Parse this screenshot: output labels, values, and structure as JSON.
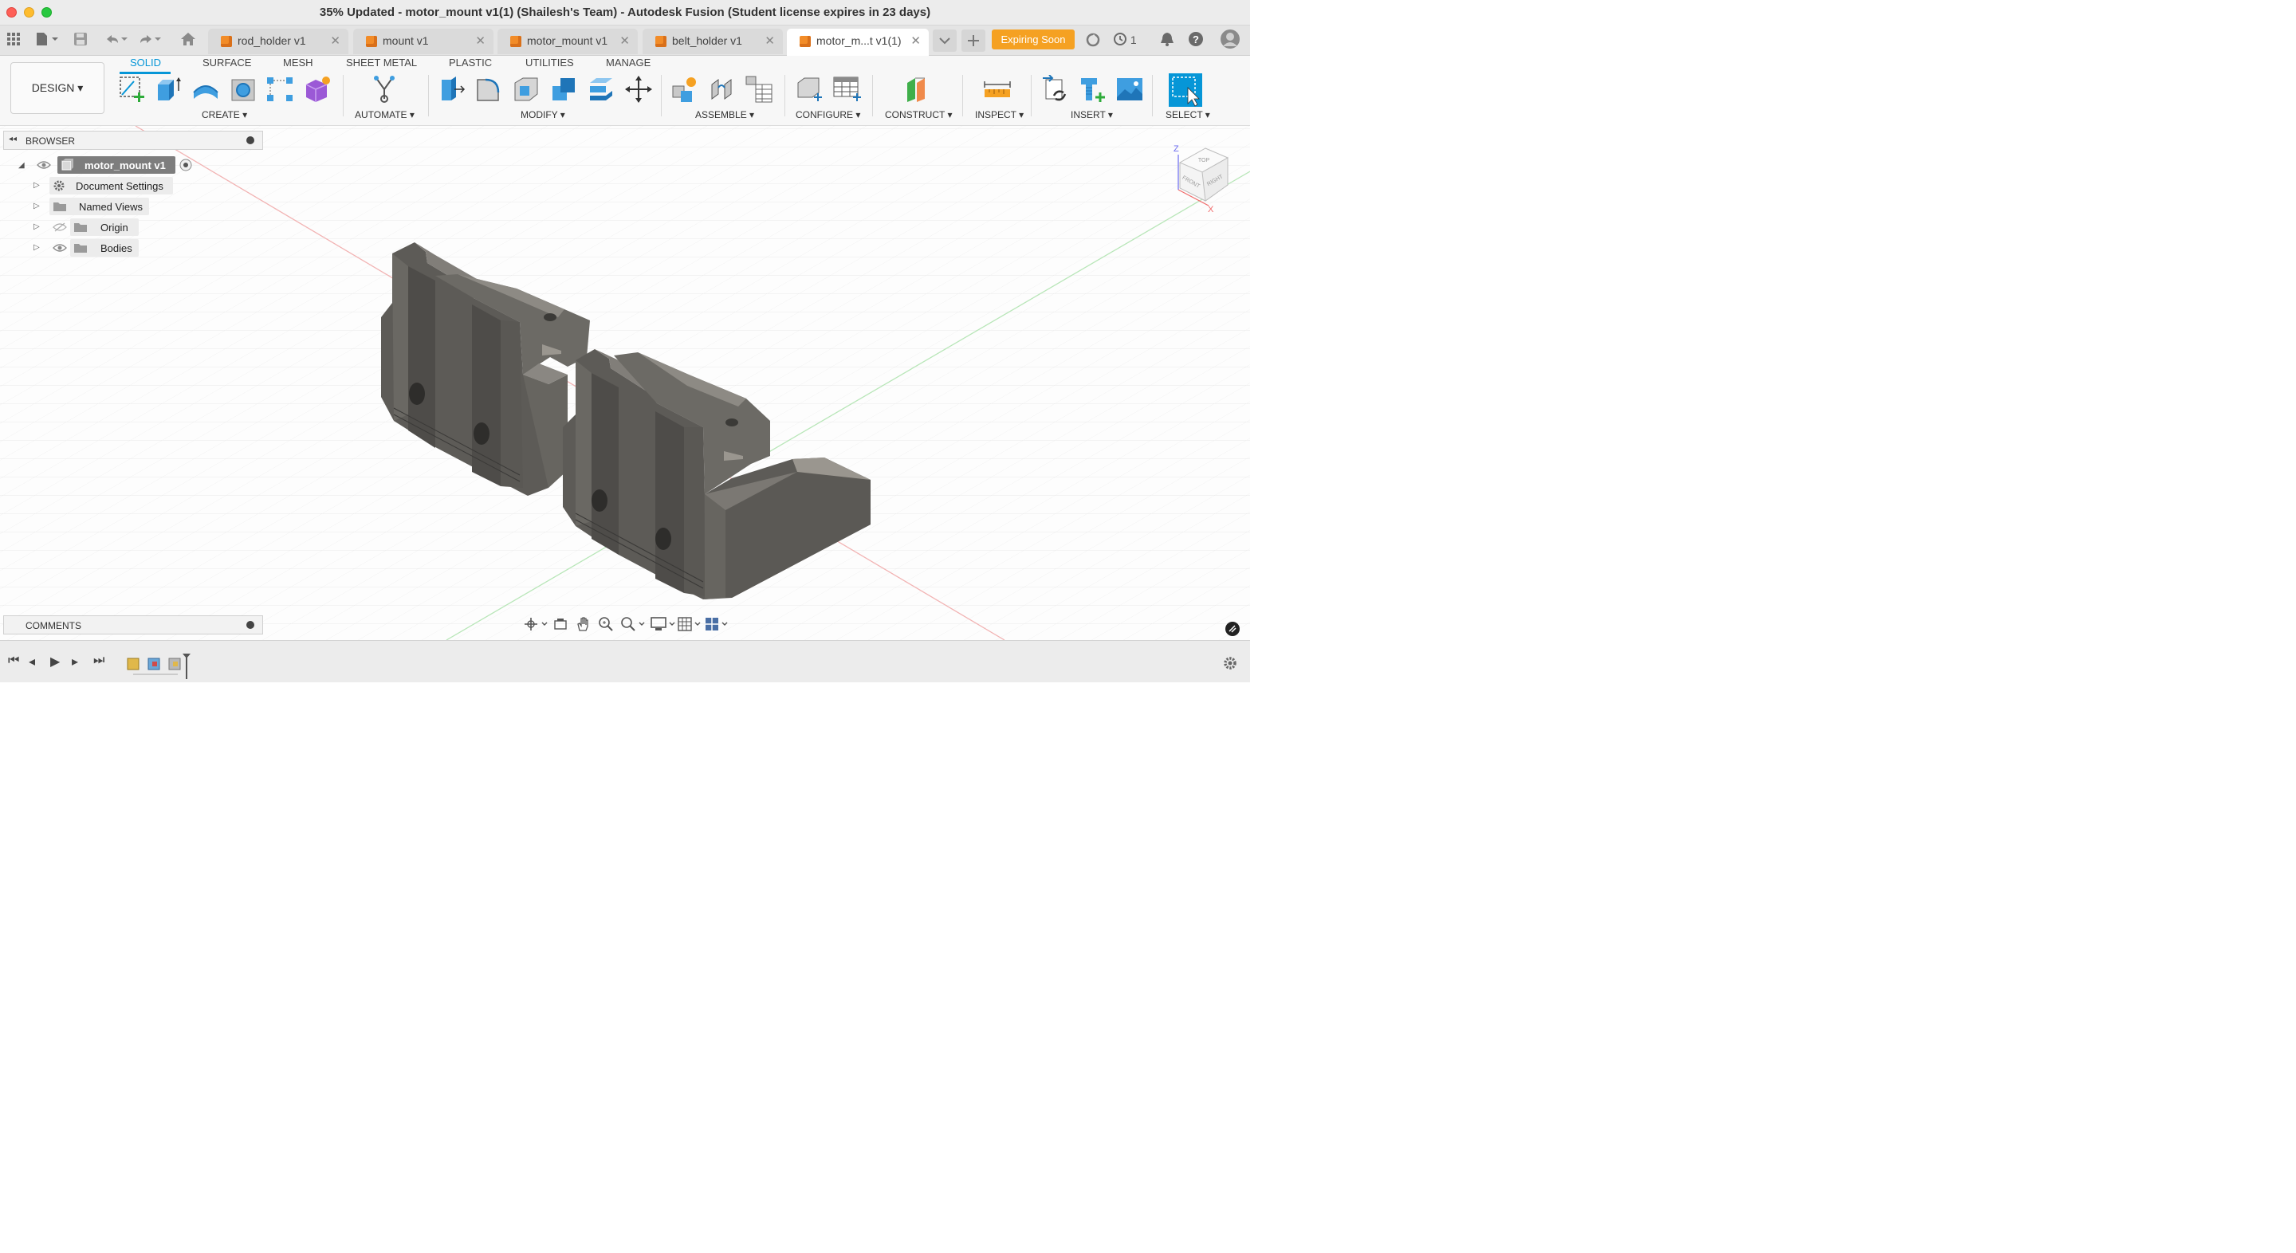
{
  "window": {
    "title": "35% Updated - motor_mount v1(1) (Shailesh's Team) - Autodesk Fusion (Student license expires in 23 days)"
  },
  "tabs": [
    {
      "label": "rod_holder v1",
      "active": false
    },
    {
      "label": "mount v1",
      "active": false
    },
    {
      "label": "motor_mount v1",
      "active": false
    },
    {
      "label": "belt_holder v1",
      "active": false
    },
    {
      "label": "motor_m...t v1(1)",
      "active": true
    }
  ],
  "header": {
    "expiring_label": "Expiring Soon",
    "jobs_count": "1",
    "close_glyph": "✕"
  },
  "workspace": {
    "design_label": "DESIGN",
    "tabs": [
      "SOLID",
      "SURFACE",
      "MESH",
      "SHEET METAL",
      "PLASTIC",
      "UTILITIES",
      "MANAGE"
    ],
    "groups": [
      "CREATE",
      "AUTOMATE",
      "MODIFY",
      "ASSEMBLE",
      "CONFIGURE",
      "CONSTRUCT",
      "INSPECT",
      "INSERT",
      "SELECT"
    ]
  },
  "browser": {
    "title": "BROWSER",
    "root": "motor_mount v1",
    "items": [
      {
        "label": "Document Settings",
        "icon": "gear-icon"
      },
      {
        "label": "Named Views",
        "icon": "folder-icon"
      },
      {
        "label": "Origin",
        "icon": "folder-icon"
      },
      {
        "label": "Bodies",
        "icon": "folder-icon"
      }
    ]
  },
  "viewcube": {
    "top": "TOP",
    "front": "FRONT",
    "right": "RIGHT",
    "z_axis": "Z",
    "x_axis": "X"
  },
  "comments": {
    "title": "COMMENTS"
  },
  "colors": {
    "accent": "#0696d7",
    "expiring": "#f5a122",
    "model": "#5b5955",
    "tab_icon": "#f28c28"
  }
}
